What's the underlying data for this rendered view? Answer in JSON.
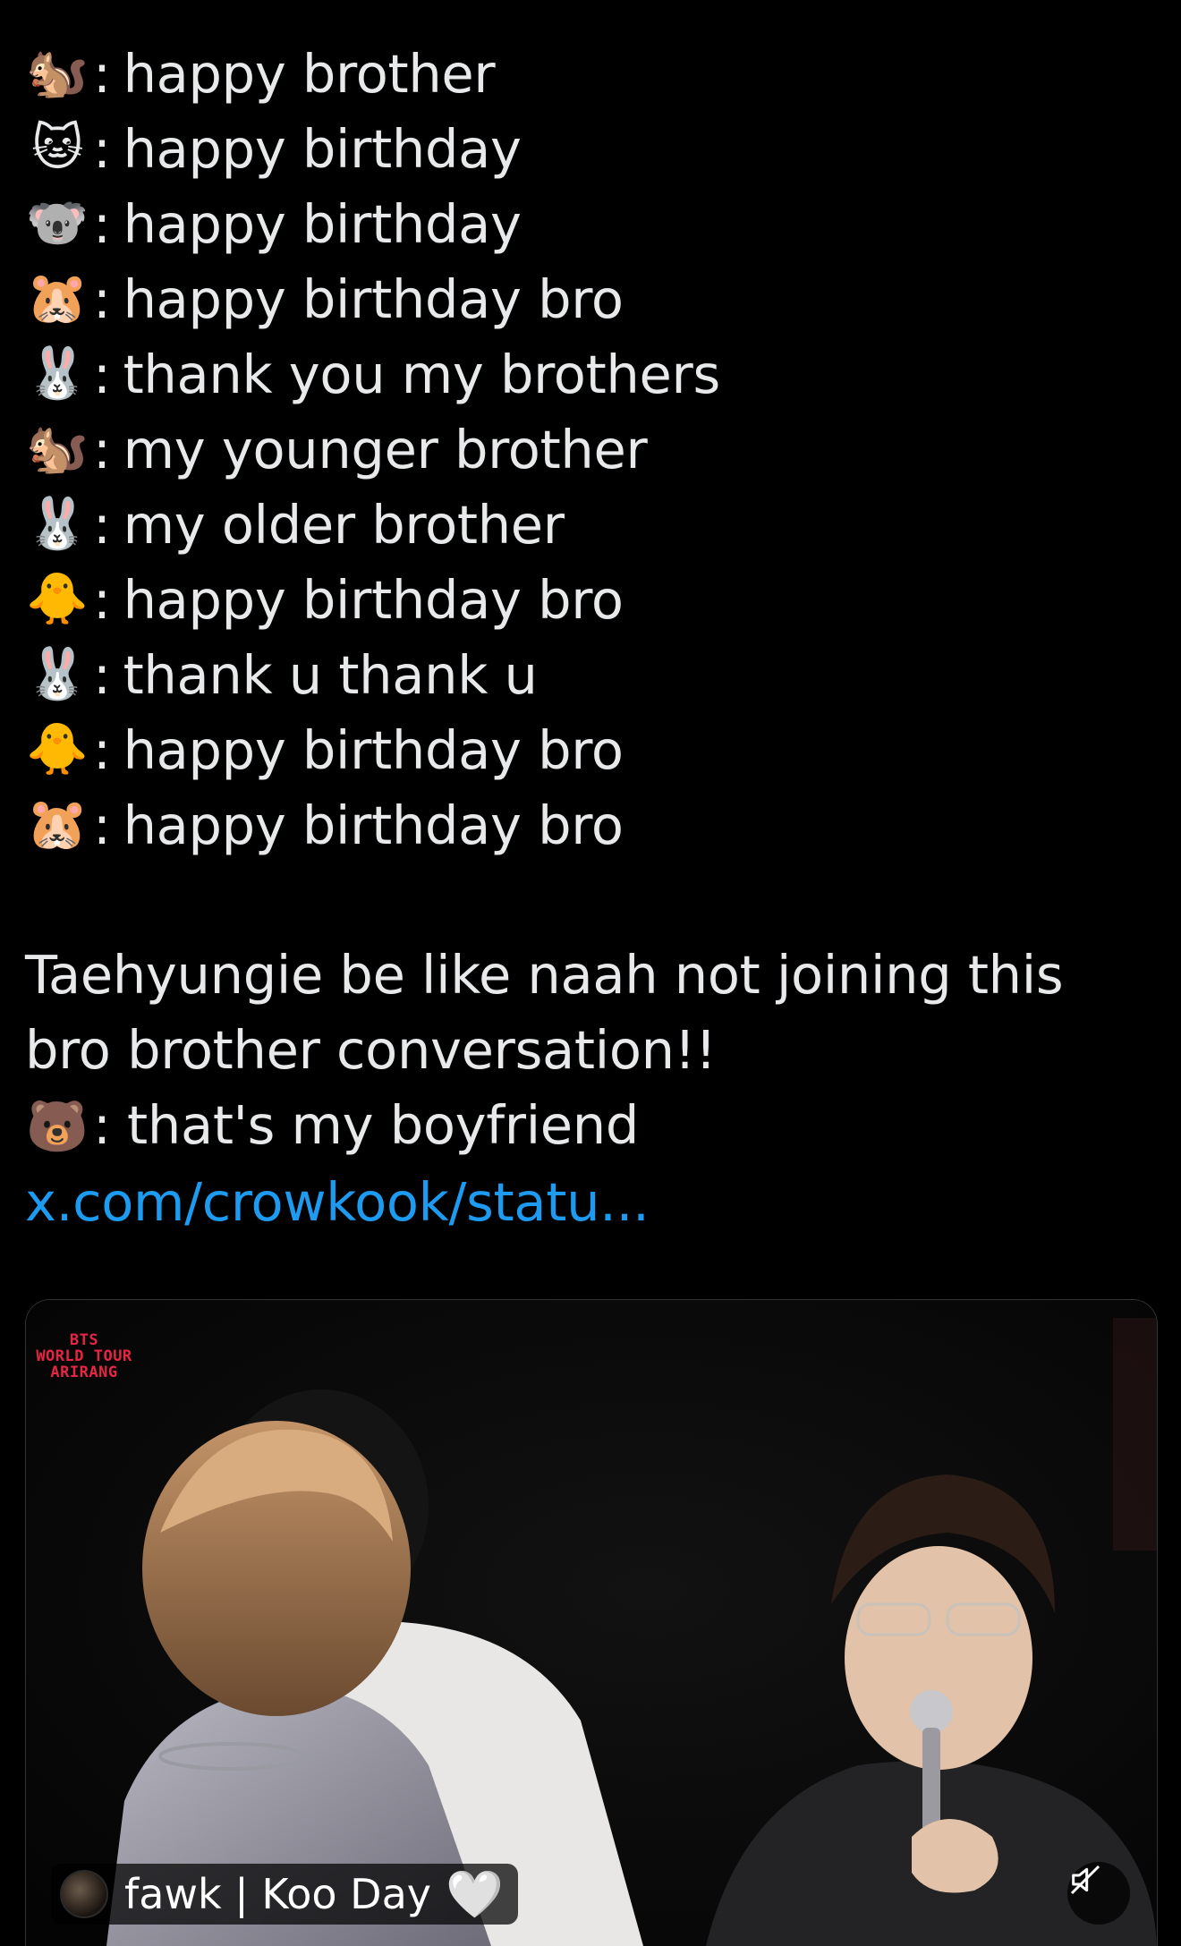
{
  "post": {
    "chat_lines": [
      {
        "emoji": "🐿️",
        "emoji_name": "chipmunk-emoji",
        "text": "happy brother"
      },
      {
        "emoji": "🐱",
        "emoji_name": "cat-emoji",
        "text": "happy birthday"
      },
      {
        "emoji": "🐨",
        "emoji_name": "koala-emoji",
        "text": "happy birthday"
      },
      {
        "emoji": "🐹",
        "emoji_name": "hamster-emoji",
        "text": "happy birthday bro"
      },
      {
        "emoji": "🐰",
        "emoji_name": "rabbit-emoji",
        "text": "thank you my brothers"
      },
      {
        "emoji": "🐿️",
        "emoji_name": "chipmunk-emoji",
        "text": "my younger brother"
      },
      {
        "emoji": "🐰",
        "emoji_name": "rabbit-emoji",
        "text": "my older brother"
      },
      {
        "emoji": "🐥",
        "emoji_name": "chick-emoji",
        "text": "happy birthday bro"
      },
      {
        "emoji": "🐰",
        "emoji_name": "rabbit-emoji",
        "text": "thank u thank u"
      },
      {
        "emoji": "🐥",
        "emoji_name": "chick-emoji",
        "text": "happy birthday bro"
      },
      {
        "emoji": "🐹",
        "emoji_name": "hamster-emoji",
        "text": "happy birthday bro"
      }
    ],
    "paragraph": "Taehyungie be like naah not joining this bro brother conversation!!",
    "last_line": {
      "emoji": "🐻",
      "emoji_name": "bear-emoji",
      "text": "that's my boyfriend ",
      "link": "x.com/crowkook/statu..."
    }
  },
  "media": {
    "watermark": [
      "BTS",
      "WORLD TOUR",
      "ARIRANG"
    ],
    "attribution": "fawk | Koo Day",
    "heart": "🤍",
    "mute_icon": "speaker-muted-icon",
    "link_color": "#1d9bf0"
  }
}
